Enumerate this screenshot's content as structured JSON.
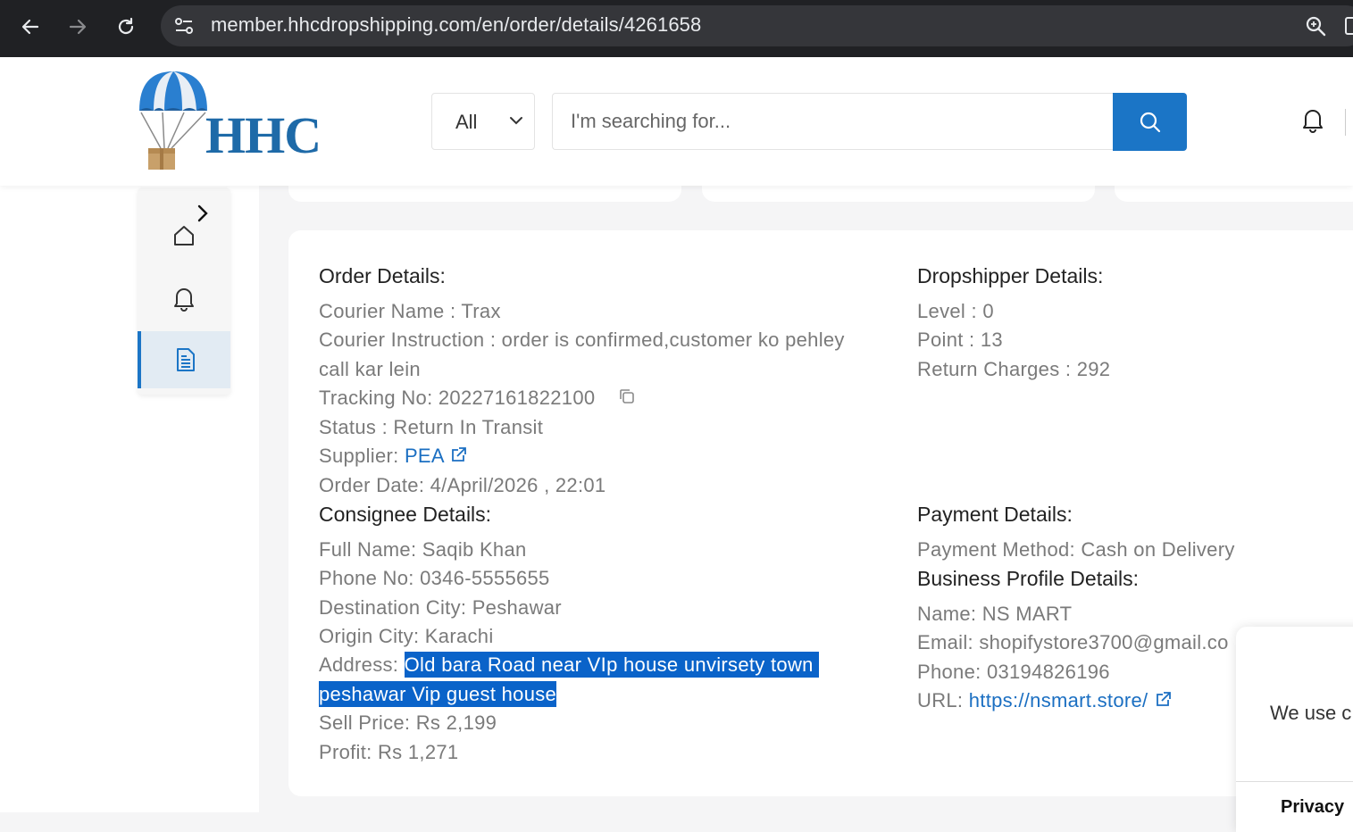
{
  "browser": {
    "url": "member.hhcdropshipping.com/en/order/details/4261658"
  },
  "header": {
    "logo_text": "HHC",
    "category_select": "All",
    "search_placeholder": "I'm searching for..."
  },
  "order_details": {
    "title": "Order Details:",
    "courier_name": "Courier Name : Trax",
    "courier_instruction_line1": "Courier Instruction : order is confirmed,customer ko pehley",
    "courier_instruction_line2": "call kar lein",
    "tracking_no": "Tracking No: 20227161822100",
    "status": "Status : Return In Transit",
    "supplier_label": "Supplier: ",
    "supplier_link": "PEA",
    "order_date": "Order Date: 4/April/2026 , 22:01"
  },
  "consignee_details": {
    "title": "Consignee Details:",
    "full_name": "Full Name: Saqib Khan",
    "phone_no": "Phone No: 0346-5555655",
    "destination_city": "Destination City: Peshawar",
    "origin_city": "Origin City: Karachi",
    "address_label": "Address: ",
    "address_line1": "Old bara Road near VIp house unvirsety town",
    "address_line2": "peshawar Vip guest house",
    "sell_price": "Sell Price: Rs 2,199",
    "profit": "Profit: Rs 1,271"
  },
  "dropshipper_details": {
    "title": "Dropshipper Details:",
    "level": "Level : 0",
    "point": "Point : 13",
    "return_charges": "Return Charges : 292"
  },
  "payment_details": {
    "title": "Payment Details:",
    "payment_method": "Payment Method: Cash on Delivery"
  },
  "business_profile_details": {
    "title": "Business Profile Details:",
    "name": "Name: NS MART",
    "email": "Email: shopifystore3700@gmail.co",
    "phone": "Phone: 03194826196",
    "url_label": "URL: ",
    "url_link": "https://nsmart.store/"
  },
  "cookie_popup": {
    "text": "We use c",
    "link": "Privacy"
  },
  "colors": {
    "accent": "#1b75c6",
    "highlight": "#0a63c9",
    "text_muted": "#7a7a7a"
  }
}
